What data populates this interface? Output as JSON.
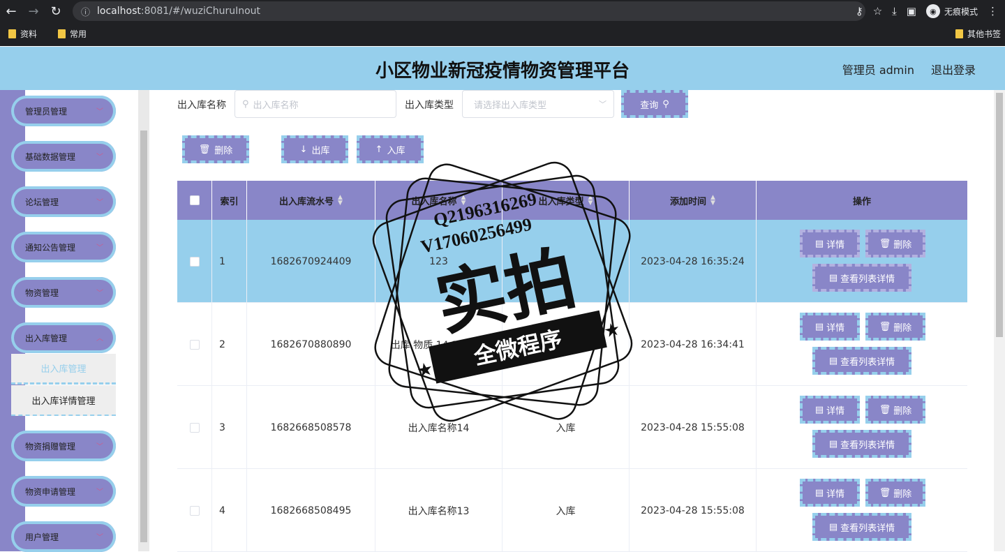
{
  "browser": {
    "url_host": "localhost",
    "url_rest": ":8081/#/wuziChuruInout",
    "incognito_label": "无痕模式",
    "bookmarks": [
      "资料",
      "常用"
    ],
    "other_bookmarks": "其他书签"
  },
  "header": {
    "title": "小区物业新冠疫情物资管理平台",
    "user": "管理员 admin",
    "logout": "退出登录"
  },
  "sidebar": {
    "items": [
      "管理员管理",
      "基础数据管理",
      "论坛管理",
      "通知公告管理",
      "物资管理",
      "出入库管理",
      "物资捐赠管理",
      "物资申请管理",
      "用户管理"
    ],
    "subitems": [
      "出入库管理",
      "出入库详情管理"
    ]
  },
  "search": {
    "name_label": "出入库名称",
    "name_placeholder": "出入库名称",
    "type_label": "出入库类型",
    "type_placeholder": "请选择出入库类型",
    "query_label": "查询"
  },
  "toolbar": {
    "delete_label": "删除",
    "out_label": "出库",
    "in_label": "入库"
  },
  "table": {
    "headers": [
      "索引",
      "出入库流水号",
      "出入库名称",
      "出入库类型",
      "添加时间",
      "操作"
    ],
    "rows": [
      {
        "index": "1",
        "serial": "1682670924409",
        "name": "123",
        "type": "",
        "time": "2023-04-28 16:35:24"
      },
      {
        "index": "2",
        "serial": "1682670880890",
        "name": "出库 物质 14 13 名称",
        "type": "",
        "time": "2023-04-28 16:34:41"
      },
      {
        "index": "3",
        "serial": "1682668508578",
        "name": "出入库名称14",
        "type": "入库",
        "time": "2023-04-28 15:55:08"
      },
      {
        "index": "4",
        "serial": "1682668508495",
        "name": "出入库名称13",
        "type": "入库",
        "time": "2023-04-28 15:55:08"
      }
    ],
    "op_detail": "详情",
    "op_delete": "删除",
    "op_list_detail": "查看列表详情"
  },
  "watermark": {
    "line1": "Q2196316269",
    "line2": "V17060256499",
    "big": "实拍",
    "banner": "全微程序"
  },
  "colors": {
    "header_bg": "#96cfec",
    "accent_purple": "#8986c8"
  }
}
